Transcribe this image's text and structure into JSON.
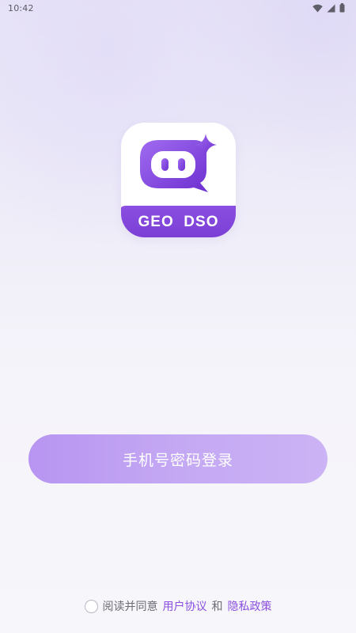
{
  "status_bar": {
    "time": "10:42",
    "icons": [
      "wifi-icon",
      "signal-icon",
      "battery-icon"
    ]
  },
  "logo": {
    "text": "GEO  DSO",
    "colors": {
      "brand_purple": "#7b3fd6",
      "brand_purple_light": "#a06cf0"
    }
  },
  "login": {
    "button_label": "手机号密码登录",
    "button_color": "#c4a8f3"
  },
  "agreement": {
    "prefix": "阅读并同意",
    "user_agreement": "用户协议",
    "conjunction": "和",
    "privacy_policy": "隐私政策",
    "link_color": "#8a4fe0",
    "checked": false
  }
}
